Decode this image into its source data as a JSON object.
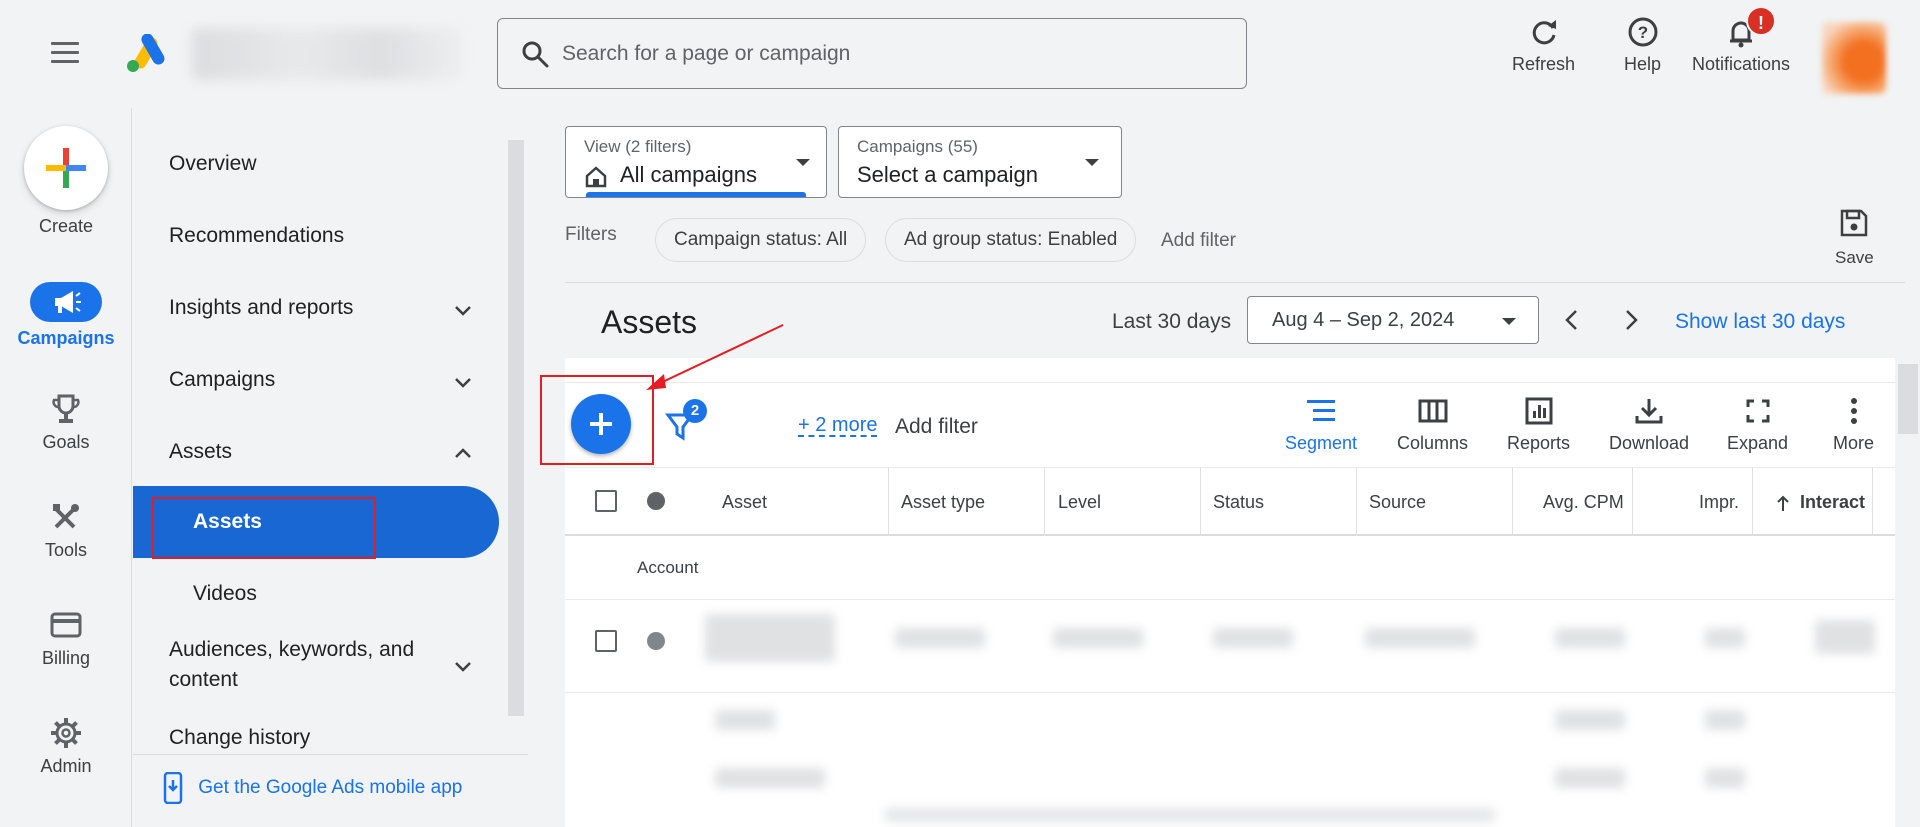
{
  "search": {
    "placeholder": "Search for a page or campaign"
  },
  "top_actions": {
    "refresh": "Refresh",
    "help": "Help",
    "notifications": "Notifications",
    "notification_badge": "!"
  },
  "rail": {
    "create": "Create",
    "campaigns": "Campaigns",
    "goals": "Goals",
    "tools": "Tools",
    "billing": "Billing",
    "admin": "Admin"
  },
  "nav": {
    "overview": "Overview",
    "recommendations": "Recommendations",
    "insights": "Insights and reports",
    "campaigns": "Campaigns",
    "assets": "Assets",
    "assets_sub": "Assets",
    "videos": "Videos",
    "audiences_line1": "Audiences, keywords, and",
    "audiences_line2": "content",
    "change_history": "Change history",
    "mobile_app": "Get the Google Ads mobile app"
  },
  "view_filter": {
    "label": "View (2 filters)",
    "value": "All campaigns"
  },
  "campaign_filter": {
    "label": "Campaigns (55)",
    "value": "Select a campaign"
  },
  "filters": {
    "label": "Filters",
    "chips": [
      "Campaign status: All",
      "Ad group status: Enabled"
    ],
    "add": "Add filter"
  },
  "save": "Save",
  "page_title": "Assets",
  "date": {
    "label": "Last 30 days",
    "range": "Aug 4 – Sep 2, 2024",
    "show_last": "Show last 30 days"
  },
  "toolbar": {
    "filter_count": "2",
    "more": "+ 2 more",
    "add_filter": "Add filter",
    "segment": "Segment",
    "columns": "Columns",
    "reports": "Reports",
    "download": "Download",
    "expand": "Expand",
    "more_menu": "More"
  },
  "table": {
    "columns": [
      "Asset",
      "Asset type",
      "Level",
      "Status",
      "Source",
      "Avg. CPM",
      "Impr.",
      "Interact"
    ],
    "group_row": "Account"
  },
  "colors": {
    "accent": "#1a73e8",
    "annotation": "#e51c23"
  }
}
